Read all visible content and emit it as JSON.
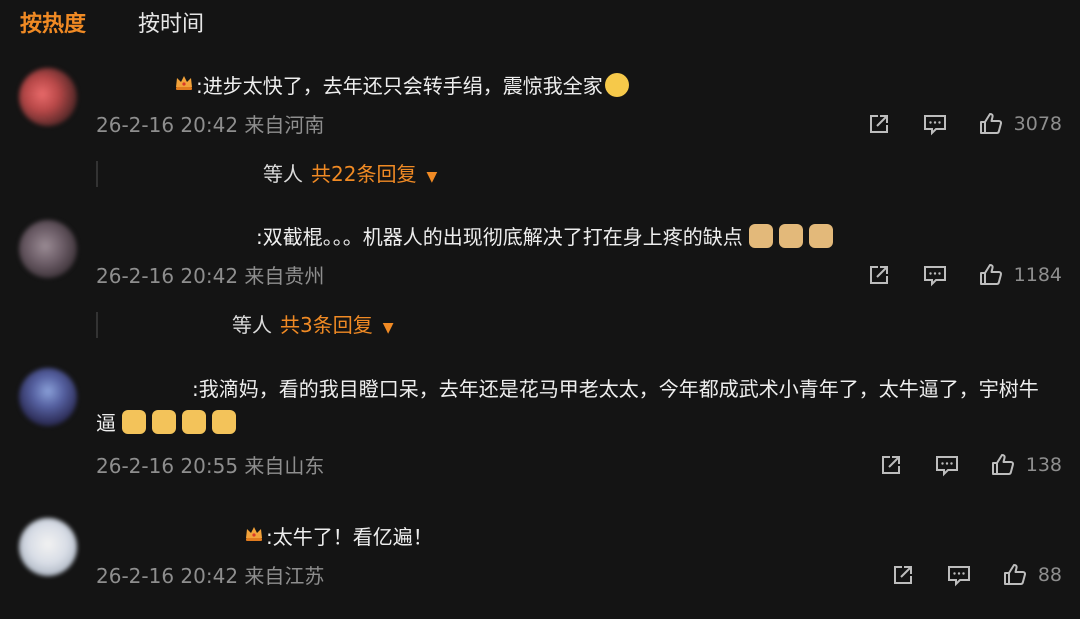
{
  "tabs": {
    "hot": "按热度",
    "time": "按时间"
  },
  "comments": [
    {
      "text": ":进步太快了，去年还只会转手绢，震惊我全家",
      "time": "26-2-16 20:42",
      "location": "来自河南",
      "likes": "3078",
      "replies_who": "等人",
      "replies_count": "共22条回复"
    },
    {
      "text": ":双截棍。。。机器人的出现彻底解决了打在身上疼的缺点",
      "time": "26-2-16 20:42",
      "location": "来自贵州",
      "likes": "1184",
      "replies_who": "等人",
      "replies_count": "共3条回复"
    },
    {
      "text": ":我滴妈，看的我目瞪口呆，去年还是花马甲老太太，今年都成武术小青年了，太牛逼了，宇树牛逼",
      "time": "26-2-16 20:55",
      "location": "来自山东",
      "likes": "138"
    },
    {
      "text": ":太牛了！看亿遍！",
      "time": "26-2-16 20:42",
      "location": "来自江苏",
      "likes": "88"
    }
  ],
  "icons": {
    "share": "share-icon",
    "comment": "comment-icon",
    "like": "thumbs-up-icon",
    "caret": "caret-down-icon",
    "crown": "crown-badge-icon"
  },
  "colors": {
    "accent": "#f08a24",
    "background": "#141414",
    "meta": "#8e8e8e"
  }
}
